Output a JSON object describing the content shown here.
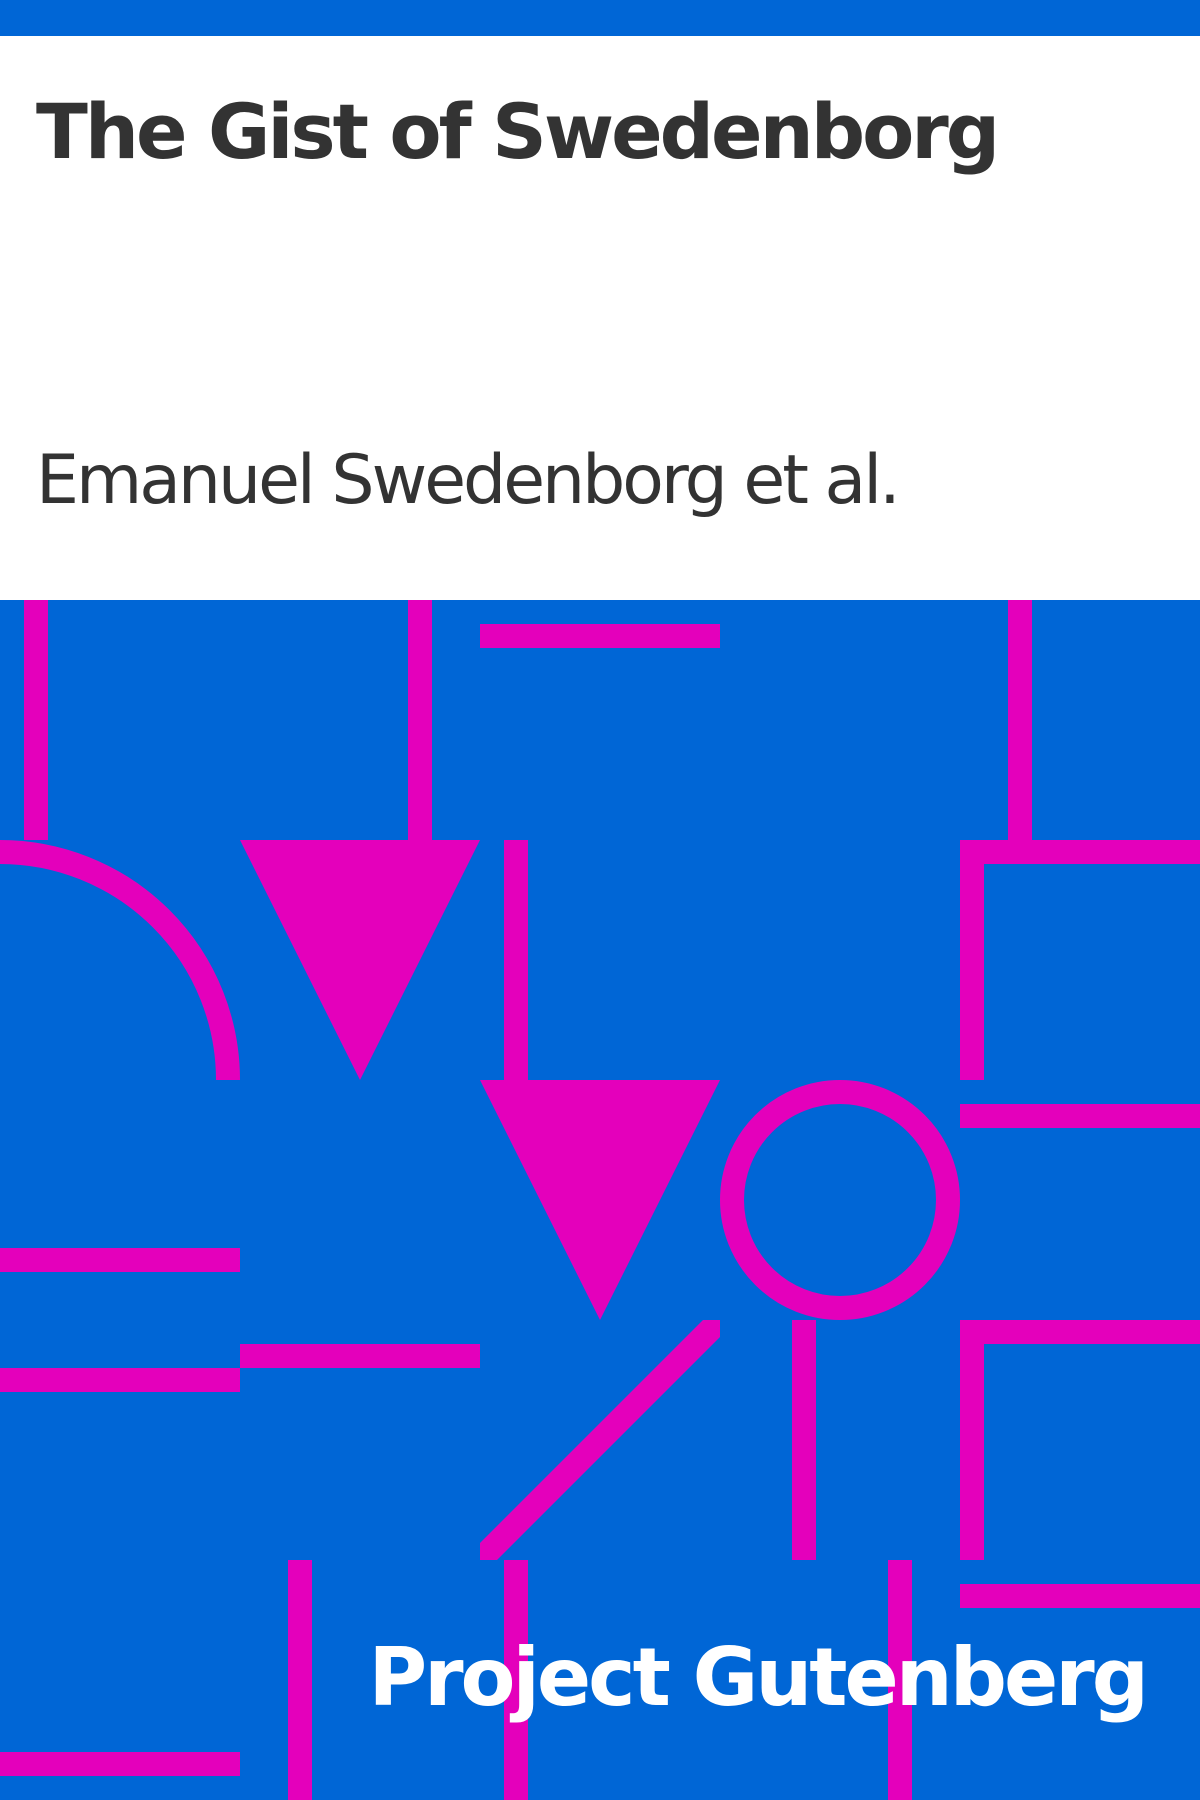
{
  "book": {
    "title": "The Gist of Swedenborg",
    "author": "Emanuel Swedenborg et al.",
    "publisher": "Project Gutenberg"
  },
  "colors": {
    "background": "#ffffff",
    "brand_blue": "#0066d6",
    "pattern_magenta": "#e400bb",
    "text_dark": "#333333",
    "text_light": "#ffffff"
  }
}
